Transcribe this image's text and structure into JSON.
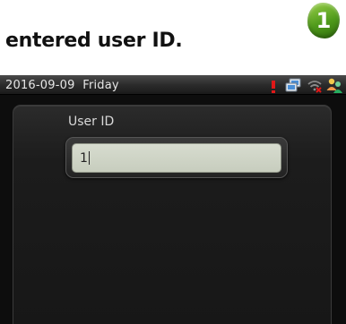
{
  "caption": "entered user ID.",
  "step_badge": "1",
  "statusbar": {
    "date": "2016-09-09  Friday",
    "icons": [
      "alert-icon",
      "network-icon",
      "wifi-off-icon",
      "users-icon"
    ]
  },
  "form": {
    "user_id_label": "User ID",
    "user_id_value": "1"
  },
  "colors": {
    "badge_green": "#4f9a1b",
    "input_bg": "#cfd4c6",
    "alert_red": "#e01818"
  }
}
